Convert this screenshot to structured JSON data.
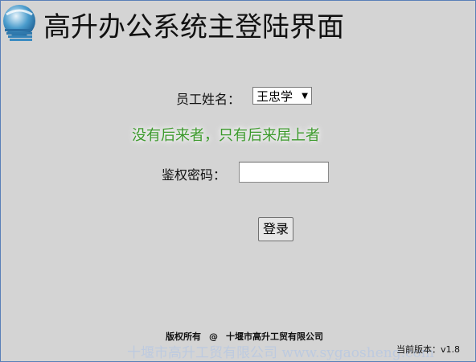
{
  "header": {
    "title": "高升办公系统主登陆界面",
    "logo_icon": "globe-logo-icon"
  },
  "form": {
    "user_label": "员工姓名：",
    "user_selected": "王忠学",
    "slogan": "没有后来者，只有后来居上者",
    "password_label": "鉴权密码：",
    "password_value": "",
    "login_label": "登录"
  },
  "footer": {
    "rights": "版权所有",
    "at": "@",
    "company": "十堰市高升工贸有限公司",
    "watermark": "十堰市高升工贸有限公司  www.sygaosheng.com",
    "version": "当前版本：v1.8"
  },
  "colors": {
    "background": "#d4d4d4",
    "slogan": "#3c9a2c",
    "frame": "#5a7fb8"
  }
}
